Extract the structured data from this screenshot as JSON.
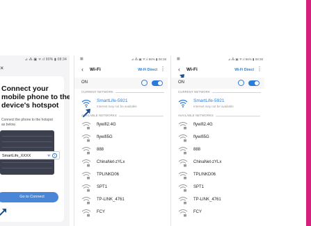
{
  "phone1": {
    "status_text": "⊿ ⁂ ▣ ᯤ.ıl 90% ▮ 08:34",
    "close_icon": "×",
    "title_lines": [
      "Connect your",
      "mobile phone to the",
      "device's hotspot"
    ],
    "description": "Connect the phone to the hotspot as below.",
    "ssid": "SmartLife_XXXX",
    "connect_button": "Go to Connect"
  },
  "phone2": {
    "status_left": "▦",
    "status_right": "⊿ ⁂ ▣ ᯤ.ıl 86% ▮ 08:38",
    "header": {
      "back": "‹",
      "title": "Wi-Fi",
      "direct": "Wi-Fi Direct",
      "more": "⋮"
    },
    "on_label": "ON",
    "current_label": "CURRENT NETWORK",
    "current_name": "SmartLife-5921",
    "current_sub": "Internet may not be available",
    "available_label": "AVAILABLE NETWORKS",
    "networks": [
      "flywifi2.4G",
      "flywifi5G",
      "888",
      "ChinaNet-zYLx",
      "TPLINKD06",
      "SPT1",
      "TP-LINK_4761",
      "FCY"
    ]
  },
  "phone3": {
    "status_left": "▦",
    "status_right": "⊿ ⁂ ▣ ᯤ.ıl 86% ▮ 08:38",
    "header": {
      "back": "‹",
      "title": "Wi-Fi",
      "direct": "Wi-Fi Direct",
      "more": "⋮"
    },
    "on_label": "ON",
    "current_label": "CURRENT NETWORK",
    "current_name": "SmartLife-5921",
    "current_sub": "Internet may not be available",
    "available_label": "AVAILABLE NETWORKS",
    "networks": [
      "flywifi2.4G",
      "flywifi5G",
      "888",
      "ChinaNet-zYLx",
      "TPLINKD06",
      "SPT1",
      "TP-LINK_4761",
      "FCY"
    ]
  },
  "colors": {
    "accent": "#2a7ad8",
    "button": "#4a86d8",
    "magenta": "#d61f7a",
    "arrow": "#1f4e8c"
  }
}
